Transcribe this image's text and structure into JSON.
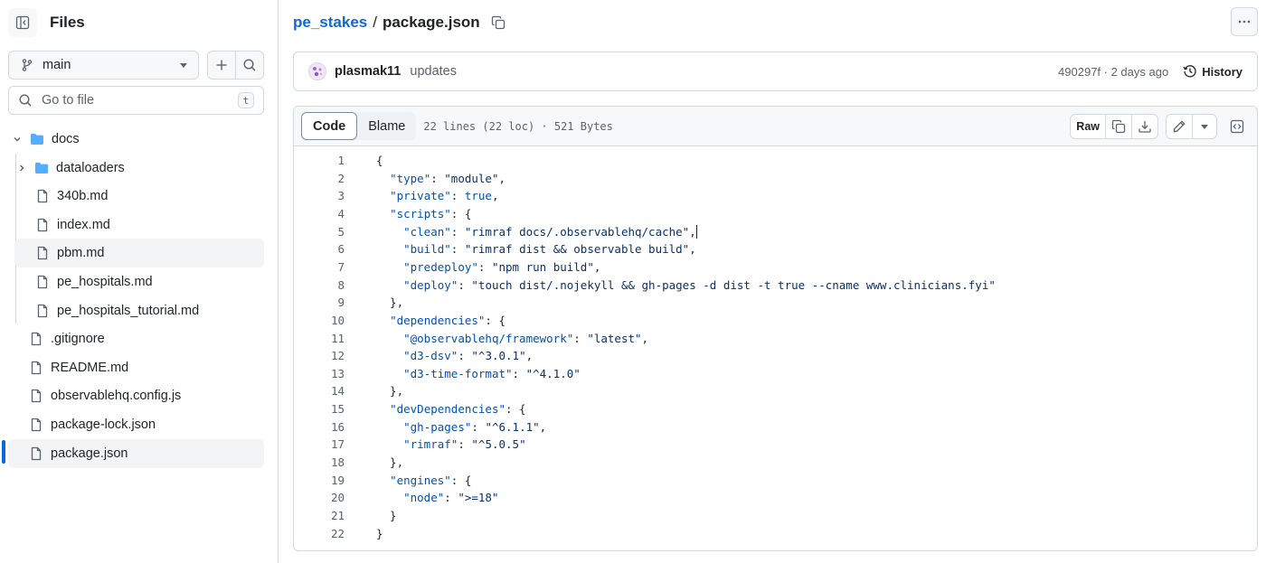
{
  "sidebar": {
    "title": "Files",
    "branch": "main",
    "go_to_file_placeholder": "Go to file",
    "go_to_file_shortcut": "t",
    "tree": [
      {
        "name": "docs",
        "type": "folder",
        "depth": 0,
        "expanded": true
      },
      {
        "name": "dataloaders",
        "type": "folder",
        "depth": 1,
        "expanded": false
      },
      {
        "name": "340b.md",
        "type": "file",
        "depth": 1
      },
      {
        "name": "index.md",
        "type": "file",
        "depth": 1
      },
      {
        "name": "pbm.md",
        "type": "file",
        "depth": 1,
        "hover": true
      },
      {
        "name": "pe_hospitals.md",
        "type": "file",
        "depth": 1
      },
      {
        "name": "pe_hospitals_tutorial.md",
        "type": "file",
        "depth": 1
      },
      {
        "name": ".gitignore",
        "type": "file",
        "depth": 0
      },
      {
        "name": "README.md",
        "type": "file",
        "depth": 0
      },
      {
        "name": "observablehq.config.js",
        "type": "file",
        "depth": 0
      },
      {
        "name": "package-lock.json",
        "type": "file",
        "depth": 0
      },
      {
        "name": "package.json",
        "type": "file",
        "depth": 0,
        "selected": true
      }
    ]
  },
  "breadcrumb": {
    "repo": "pe_stakes",
    "separator": "/",
    "file": "package.json"
  },
  "commit": {
    "author": "plasmak11",
    "message": "updates",
    "meta": "490297f · 2 days ago",
    "history_label": "History"
  },
  "file": {
    "tab_code": "Code",
    "tab_blame": "Blame",
    "info": "22 lines (22 loc) · 521 Bytes",
    "raw_label": "Raw"
  },
  "code_lines": [
    [
      [
        "p",
        "{"
      ]
    ],
    [
      [
        "p",
        "  "
      ],
      [
        "k",
        "\"type\""
      ],
      [
        "p",
        ": "
      ],
      [
        "s",
        "\"module\""
      ],
      [
        "p",
        ","
      ]
    ],
    [
      [
        "p",
        "  "
      ],
      [
        "k",
        "\"private\""
      ],
      [
        "p",
        ": "
      ],
      [
        "c",
        "true"
      ],
      [
        "p",
        ","
      ]
    ],
    [
      [
        "p",
        "  "
      ],
      [
        "k",
        "\"scripts\""
      ],
      [
        "p",
        ": {"
      ]
    ],
    [
      [
        "p",
        "    "
      ],
      [
        "k",
        "\"clean\""
      ],
      [
        "p",
        ": "
      ],
      [
        "s",
        "\"rimraf docs/.observablehq/cache\""
      ],
      [
        "p",
        ","
      ]
    ],
    [
      [
        "p",
        "    "
      ],
      [
        "k",
        "\"build\""
      ],
      [
        "p",
        ": "
      ],
      [
        "s",
        "\"rimraf dist && observable build\""
      ],
      [
        "p",
        ","
      ]
    ],
    [
      [
        "p",
        "    "
      ],
      [
        "k",
        "\"predeploy\""
      ],
      [
        "p",
        ": "
      ],
      [
        "s",
        "\"npm run build\""
      ],
      [
        "p",
        ","
      ]
    ],
    [
      [
        "p",
        "    "
      ],
      [
        "k",
        "\"deploy\""
      ],
      [
        "p",
        ": "
      ],
      [
        "s",
        "\"touch dist/.nojekyll && gh-pages -d dist -t true --cname www.clinicians.fyi\""
      ]
    ],
    [
      [
        "p",
        "  },"
      ]
    ],
    [
      [
        "p",
        "  "
      ],
      [
        "k",
        "\"dependencies\""
      ],
      [
        "p",
        ": {"
      ]
    ],
    [
      [
        "p",
        "    "
      ],
      [
        "k",
        "\"@observablehq/framework\""
      ],
      [
        "p",
        ": "
      ],
      [
        "s",
        "\"latest\""
      ],
      [
        "p",
        ","
      ]
    ],
    [
      [
        "p",
        "    "
      ],
      [
        "k",
        "\"d3-dsv\""
      ],
      [
        "p",
        ": "
      ],
      [
        "s",
        "\"^3.0.1\""
      ],
      [
        "p",
        ","
      ]
    ],
    [
      [
        "p",
        "    "
      ],
      [
        "k",
        "\"d3-time-format\""
      ],
      [
        "p",
        ": "
      ],
      [
        "s",
        "\"^4.1.0\""
      ]
    ],
    [
      [
        "p",
        "  },"
      ]
    ],
    [
      [
        "p",
        "  "
      ],
      [
        "k",
        "\"devDependencies\""
      ],
      [
        "p",
        ": {"
      ]
    ],
    [
      [
        "p",
        "    "
      ],
      [
        "k",
        "\"gh-pages\""
      ],
      [
        "p",
        ": "
      ],
      [
        "s",
        "\"^6.1.1\""
      ],
      [
        "p",
        ","
      ]
    ],
    [
      [
        "p",
        "    "
      ],
      [
        "k",
        "\"rimraf\""
      ],
      [
        "p",
        ": "
      ],
      [
        "s",
        "\"^5.0.5\""
      ]
    ],
    [
      [
        "p",
        "  },"
      ]
    ],
    [
      [
        "p",
        "  "
      ],
      [
        "k",
        "\"engines\""
      ],
      [
        "p",
        ": {"
      ]
    ],
    [
      [
        "p",
        "    "
      ],
      [
        "k",
        "\"node\""
      ],
      [
        "p",
        ": "
      ],
      [
        "s",
        "\">=18\""
      ]
    ],
    [
      [
        "p",
        "  }"
      ]
    ],
    [
      [
        "p",
        "}"
      ]
    ]
  ],
  "colors": {
    "accent": "#0969da",
    "key": "#0550ae",
    "string": "#0a3069",
    "folder": "#54aeff"
  }
}
